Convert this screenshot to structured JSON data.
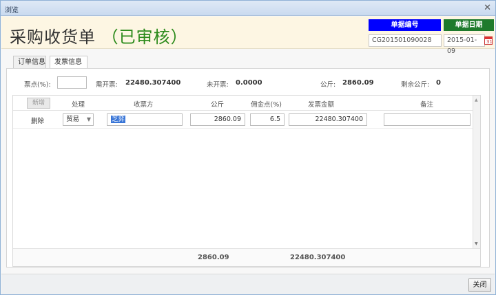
{
  "window": {
    "title": "浏览",
    "close_glyph": "✕"
  },
  "header": {
    "title": "采购收货单",
    "status": "（已审核）",
    "doc_no_label": "单据编号",
    "doc_date_label": "单据日期",
    "doc_no": "CG201501090028",
    "doc_date": "2015-01-09",
    "calendar_day": "31"
  },
  "tabs": [
    {
      "label": "订单信息",
      "active": false
    },
    {
      "label": "发票信息",
      "active": true
    }
  ],
  "summary": {
    "ticket_pct_label": "票点(%):",
    "need_invoice_label": "需开票:",
    "need_invoice_value": "22480.307400",
    "not_invoiced_label": "未开票:",
    "not_invoiced_value": "0.0000",
    "kg_label": "公斤:",
    "kg_value": "2860.09",
    "remaining_kg_label": "剩余公斤:",
    "remaining_kg_value": "0"
  },
  "grid": {
    "add_label": "新增",
    "headers": {
      "action": "处理",
      "payee": "收票方",
      "kg": "公斤",
      "commission": "佣金点(%)",
      "amount": "发票金额",
      "note": "备注"
    },
    "rows": [
      {
        "delete_label": "删除",
        "type": "贸易",
        "payee": "芝弈",
        "kg": "2860.09",
        "commission": "6.5",
        "amount": "22480.307400",
        "note": ""
      }
    ],
    "footer": {
      "kg_total": "2860.09",
      "amount_total": "22480.307400"
    }
  },
  "buttons": {
    "close": "关闭"
  },
  "colors": {
    "doc_no_badge": "#0000ff",
    "doc_date_badge": "#1e7a2c",
    "status": "#2a8a1a",
    "header_bg": "#fdf6e3"
  }
}
